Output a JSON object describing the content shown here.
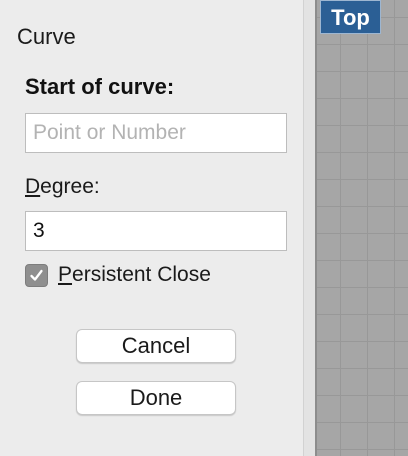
{
  "dialog": {
    "title": "Curve",
    "heading": "Start of curve:",
    "start_input": {
      "placeholder": "Point or Number",
      "value": ""
    },
    "degree": {
      "label_mnemonic": "D",
      "label_rest": "egree:",
      "value": "3"
    },
    "persistent_close": {
      "checked": true,
      "label_mnemonic": "P",
      "label_rest": "ersistent Close"
    },
    "buttons": {
      "cancel": "Cancel",
      "done": "Done"
    }
  },
  "viewport": {
    "label": "Top",
    "label_color": "#2b5f95",
    "background_color": "#a6a6a6"
  },
  "icons": {
    "checkbox": "checkmark-icon"
  }
}
